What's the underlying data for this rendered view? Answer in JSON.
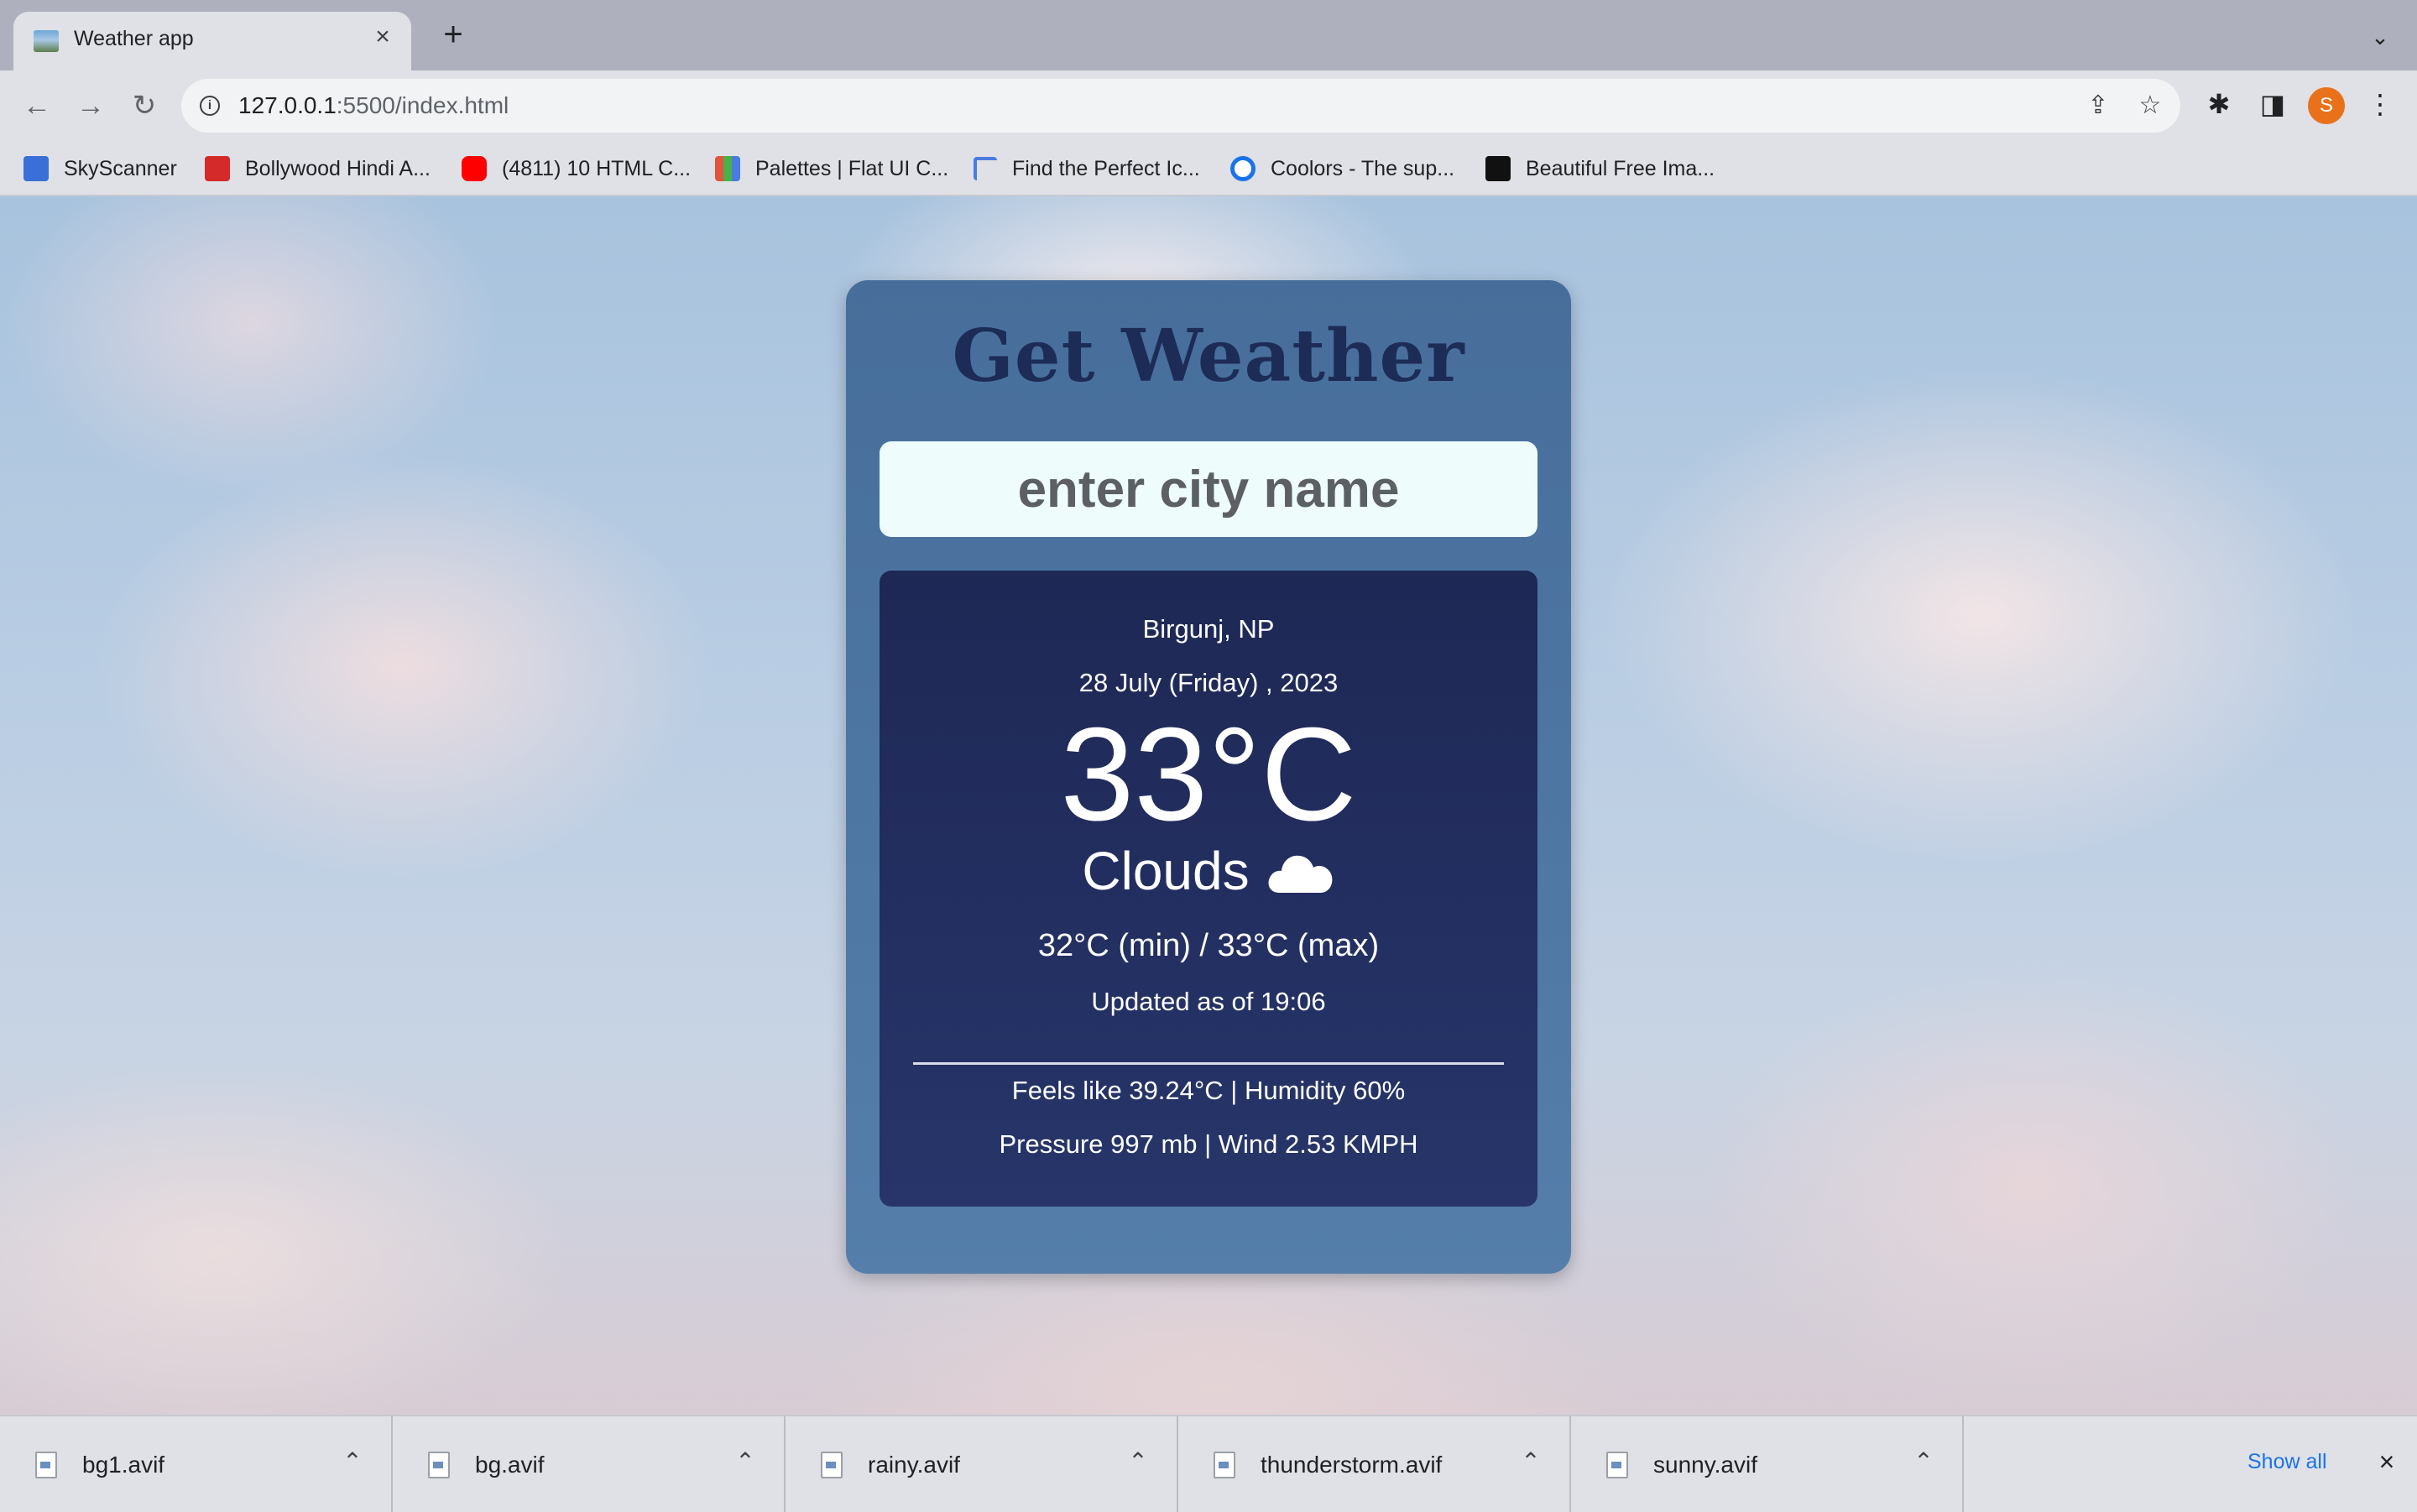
{
  "browser": {
    "tab_title": "Weather app",
    "tab_close": "×",
    "new_tab": "+",
    "tab_menu": "⌄",
    "url_host": "127.0.0.1",
    "url_rest": ":5500/index.html",
    "profile_initial": "S",
    "icons": [
      "back-icon",
      "forward-icon",
      "reload-icon",
      "info-icon",
      "share-icon",
      "star-icon",
      "extensions-icon",
      "sidebar-icon",
      "menu-icon"
    ]
  },
  "bookmarks": [
    {
      "label": "SkyScanner",
      "color": "#3b6fd8"
    },
    {
      "label": "Bollywood Hindi A...",
      "color": "#d42a2a"
    },
    {
      "label": "(4811) 10 HTML C...",
      "color": "#ff0000"
    },
    {
      "label": "Palettes | Flat UI C...",
      "color": "#e08a3c"
    },
    {
      "label": "Find the Perfect Ic...",
      "color": "#4a7be0"
    },
    {
      "label": "Coolors - The sup...",
      "color": "#1a73e8"
    },
    {
      "label": "Beautiful Free Ima...",
      "color": "#111111"
    }
  ],
  "app": {
    "title": "Get Weather",
    "search_placeholder": "enter city name",
    "location": "Birgunj, NP",
    "date": "28 July (Friday) , 2023",
    "temperature": "33°C",
    "condition": "Clouds",
    "condition_icon": "cloud-icon",
    "min_max": "32°C (min) / 33°C (max)",
    "updated": "Updated as of 19:06",
    "feels_humidity": "Feels like 39.24°C | Humidity 60%",
    "pressure_wind": "Pressure 997 mb | Wind 2.53 KMPH"
  },
  "downloads": {
    "items": [
      {
        "name": "bg1.avif"
      },
      {
        "name": "bg.avif"
      },
      {
        "name": "rainy.avif"
      },
      {
        "name": "thunderstorm.avif"
      },
      {
        "name": "sunny.avif"
      }
    ],
    "show_all": "Show all",
    "close": "×"
  }
}
